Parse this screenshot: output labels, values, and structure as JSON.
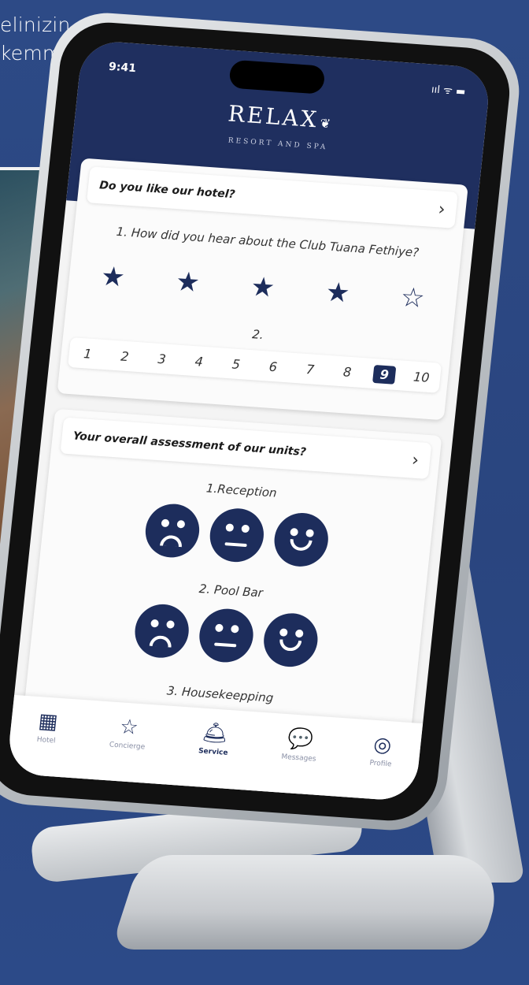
{
  "background": {
    "line1": "elinizin",
    "line2": "kemmel"
  },
  "status": {
    "time": "9:41",
    "icons": "ııl ᯤ ▬"
  },
  "brand": {
    "name": "RELAX",
    "tagline": "RESORT AND SPA"
  },
  "survey1": {
    "title": "Do you like our hotel?",
    "question1": "1. How did you hear about the Club Tuana Fethiye?",
    "rating": 4,
    "max_stars": 5,
    "question2": "2.",
    "numbers": [
      "1",
      "2",
      "3",
      "4",
      "5",
      "6",
      "7",
      "8",
      "9",
      "10"
    ],
    "selected": "9"
  },
  "survey2": {
    "title": "Your overall assessment of our units?",
    "units": [
      {
        "label": "1.Reception"
      },
      {
        "label": "2. Pool Bar"
      },
      {
        "label": "3. Housekeepping"
      }
    ]
  },
  "tabs": [
    {
      "label": "Hotel",
      "icon": "hotel-icon"
    },
    {
      "label": "Concierge",
      "icon": "star-icon"
    },
    {
      "label": "Service",
      "icon": "service-bell-icon"
    },
    {
      "label": "Messages",
      "icon": "chat-icon"
    },
    {
      "label": "Profile",
      "icon": "user-icon"
    }
  ],
  "colors": {
    "navy": "#1d2d5c",
    "page_bg": "#2e4a86"
  }
}
